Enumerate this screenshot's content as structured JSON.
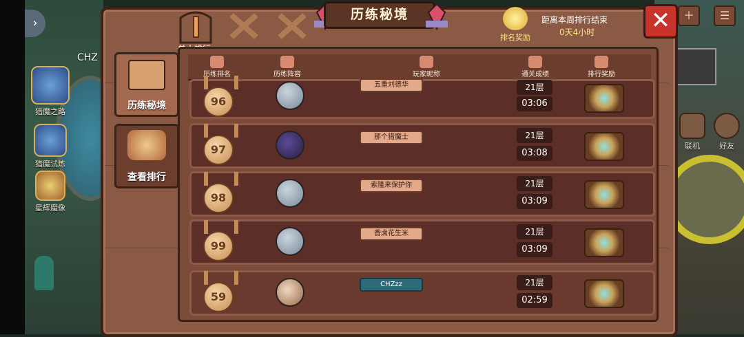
{
  "background": {
    "player_label": "CHZ",
    "left_menu": [
      {
        "label": "猎魔之路",
        "icon": "blade-crest-icon"
      },
      {
        "label": "猎魔试炼",
        "icon": "crown-shield-icon"
      },
      {
        "label": "星辉魔像",
        "icon": "golem-icon"
      }
    ],
    "right_menu": [
      {
        "label": "联机",
        "icon": "multiplayer-icon"
      },
      {
        "label": "好友",
        "icon": "friends-icon"
      }
    ]
  },
  "panel": {
    "title": "历练秘境",
    "close_label": "✕",
    "tabs": [
      {
        "label": "单人排行",
        "icon": "sword-icon",
        "active": true
      },
      {
        "label": "",
        "icon": "crossed-swords-icon",
        "active": false
      },
      {
        "label": "",
        "icon": "crossed-swords-icon",
        "active": false
      }
    ],
    "reward_label": "排名奖励",
    "timer_label": "距离本周排行结束",
    "timer_value": "0天4小时",
    "side_menu": [
      {
        "label": "历练秘境",
        "active": false
      },
      {
        "label": "查看排行",
        "active": true
      }
    ],
    "columns": [
      "历练排名",
      "历练阵容",
      "玩家昵称",
      "通关成绩",
      "排行奖励"
    ]
  },
  "rows": [
    {
      "rank": "96",
      "nickname": "五重刘德华",
      "floor": "21层",
      "time": "03:06",
      "avatar": "knight",
      "self": false
    },
    {
      "rank": "97",
      "nickname": "那个猎魔士",
      "floor": "21层",
      "time": "03:08",
      "avatar": "wiz",
      "self": false
    },
    {
      "rank": "98",
      "nickname": "索隆来保护你",
      "floor": "21层",
      "time": "03:09",
      "avatar": "knight",
      "self": false
    },
    {
      "rank": "99",
      "nickname": "香卤花生米",
      "floor": "21层",
      "time": "03:09",
      "avatar": "knight",
      "self": false
    },
    {
      "rank": "59",
      "nickname": "CHZzz",
      "floor": "21层",
      "time": "02:59",
      "avatar": "dwarf",
      "self": true
    }
  ],
  "colors": {
    "panel": "#8a5a45",
    "row": "#5c2e28",
    "close": "#c8342c",
    "self_nick": "#2e6a78"
  }
}
